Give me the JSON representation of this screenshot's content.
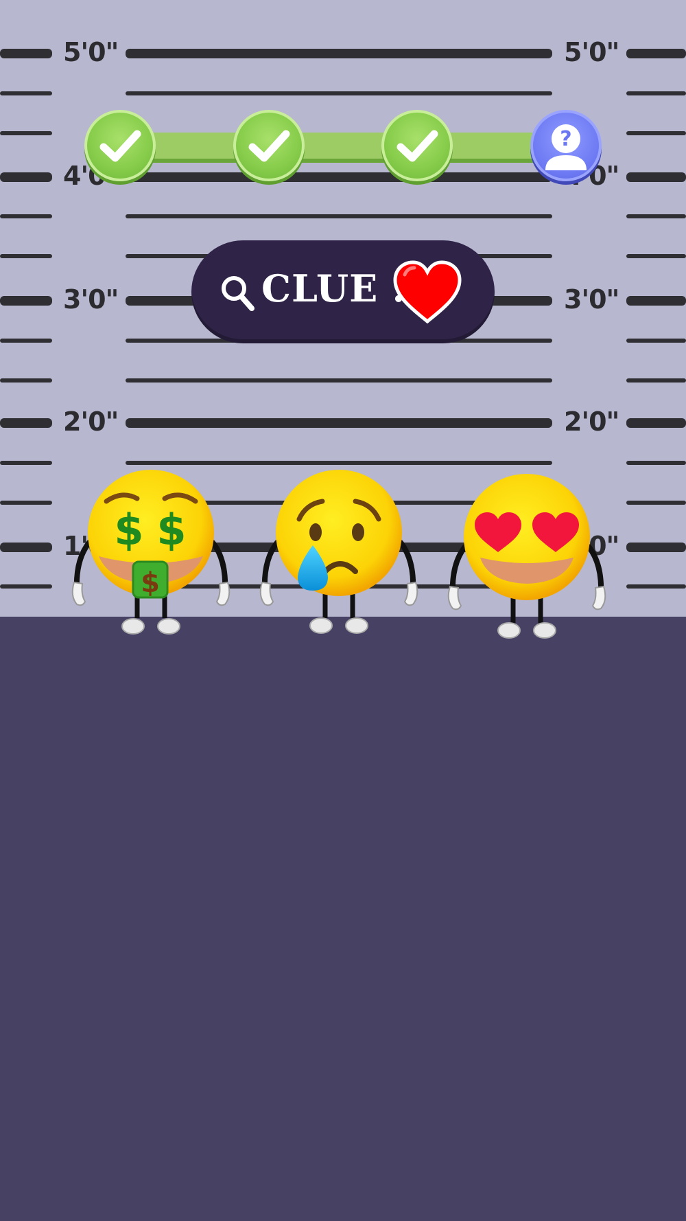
{
  "height_chart": {
    "labels": [
      "5'0\"",
      "4'0\"",
      "3'0\"",
      "2'0\"",
      "1'0\""
    ]
  },
  "progress": {
    "steps": [
      {
        "state": "done",
        "icon": "checkmark-icon"
      },
      {
        "state": "done",
        "icon": "checkmark-icon"
      },
      {
        "state": "done",
        "icon": "checkmark-icon"
      },
      {
        "state": "current",
        "icon": "question-suspect-icon"
      }
    ]
  },
  "clue": {
    "label": "CLUE :",
    "search_icon": "magnifier-icon",
    "hint_icon": "red-heart-icon"
  },
  "suspects": [
    {
      "name": "money-mouth-emoji"
    },
    {
      "name": "crying-emoji"
    },
    {
      "name": "heart-eyes-emoji"
    }
  ],
  "colors": {
    "wall": "#b7b7cf",
    "floor": "#474263",
    "progress_done": "#86cc4a",
    "progress_current": "#6b78f2",
    "clue_bg": "#2f2448",
    "heart": "#ff0000"
  }
}
